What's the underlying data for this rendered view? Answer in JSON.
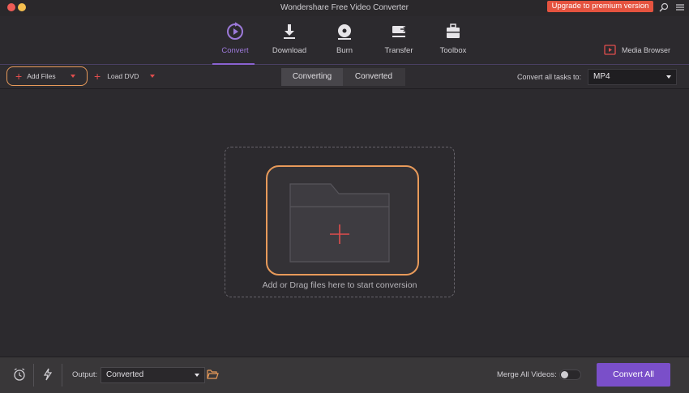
{
  "window": {
    "title": "Wondershare Free Video Converter",
    "upgrade_label": "Upgrade to premium version"
  },
  "nav": {
    "tabs": [
      {
        "label": "Convert",
        "icon": "convert-icon",
        "active": true
      },
      {
        "label": "Download",
        "icon": "download-icon"
      },
      {
        "label": "Burn",
        "icon": "burn-icon"
      },
      {
        "label": "Transfer",
        "icon": "transfer-icon"
      },
      {
        "label": "Toolbox",
        "icon": "toolbox-icon"
      }
    ],
    "media_browser_label": "Media Browser"
  },
  "toolbar": {
    "add_files_label": "Add Files",
    "load_dvd_label": "Load DVD",
    "segment": {
      "converting": "Converting",
      "converted": "Converted",
      "active": "Converting"
    },
    "convert_all_tasks_label": "Convert all tasks to:",
    "format_value": "MP4"
  },
  "dropzone": {
    "hint": "Add or Drag files here to start conversion"
  },
  "footer": {
    "output_label": "Output:",
    "output_value": "Converted",
    "merge_label": "Merge All Videos:",
    "merge_enabled": false,
    "convert_all_label": "Convert All"
  },
  "colors": {
    "accent": "#7a4fc9",
    "highlight": "#e89a5a",
    "upgrade": "#e5533f",
    "add": "#e04d4d"
  }
}
